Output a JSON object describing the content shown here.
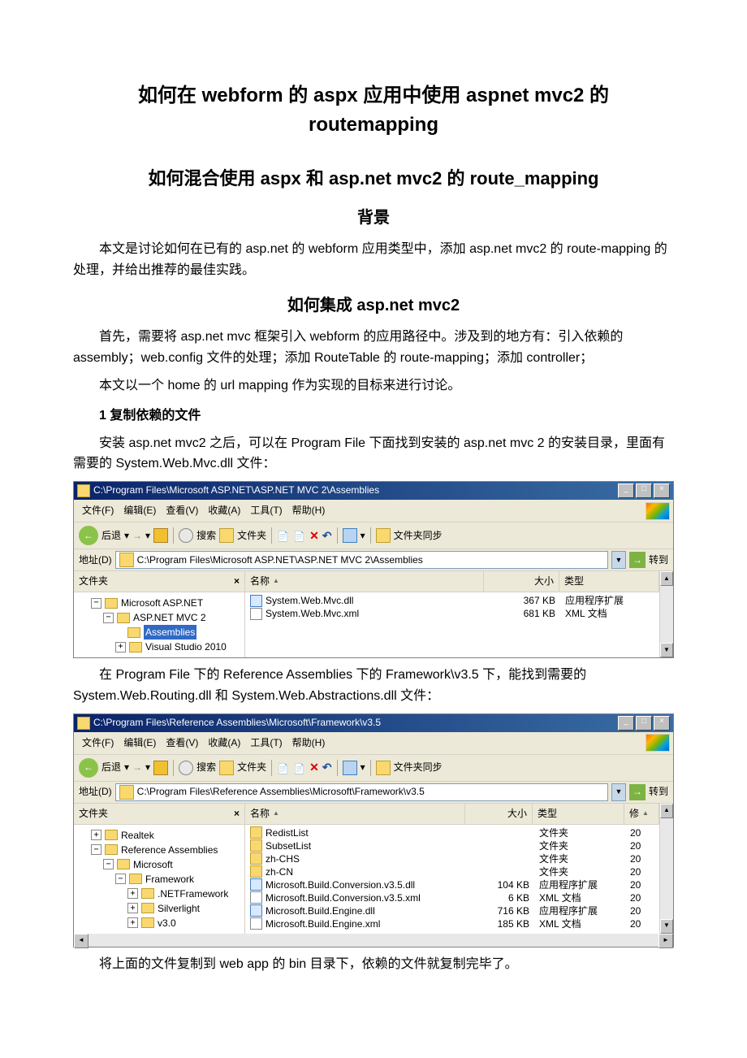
{
  "title": "如何在 webform 的 aspx 应用中使用 aspnet mvc2 的 routemapping",
  "subtitle": "如何混合使用 aspx 和 asp.net mvc2 的 route_mapping",
  "sec1": {
    "h": "背景",
    "p1": "本文是讨论如何在已有的 asp.net 的 webform 应用类型中，添加 asp.net mvc2 的 route-mapping 的处理，并给出推荐的最佳实践。"
  },
  "sec2": {
    "h": "如何集成 asp.net mvc2",
    "p1": "首先，需要将 asp.net mvc 框架引入 webform 的应用路径中。涉及到的地方有：引入依赖的 assembly；web.config 文件的处理；添加 RouteTable 的 route-mapping；添加 controller；",
    "p2": "本文以一个 home 的 url mapping 作为实现的目标来进行讨论。",
    "h2": "1 复制依赖的文件",
    "p3": "安装 asp.net mvc2 之后，可以在 Program File 下面找到安装的 asp.net mvc 2 的安装目录，里面有需要的 System.Web.Mvc.dll 文件：",
    "p4": "在 Program File 下的 Reference Assemblies 下的 Framework\\v3.5 下，能找到需要的 System.Web.Routing.dll 和 System.Web.Abstractions.dll 文件：",
    "p5": "将上面的文件复制到 web app 的 bin 目录下，依赖的文件就复制完毕了。"
  },
  "win": {
    "menu": {
      "file": "文件(F)",
      "edit": "编辑(E)",
      "view": "查看(V)",
      "fav": "收藏(A)",
      "tools": "工具(T)",
      "help": "帮助(H)"
    },
    "tb": {
      "back": "后退",
      "search": "搜索",
      "folders": "文件夹",
      "sync": "文件夹同步"
    },
    "addr": {
      "label": "地址(D)",
      "go": "转到"
    },
    "left": {
      "title": "文件夹"
    },
    "cols": {
      "name": "名称",
      "size": "大小",
      "type": "类型",
      "mod": "修"
    }
  },
  "exp1": {
    "title": "C:\\Program Files\\Microsoft ASP.NET\\ASP.NET MVC 2\\Assemblies",
    "addr": "C:\\Program Files\\Microsoft ASP.NET\\ASP.NET MVC 2\\Assemblies",
    "tree": {
      "n1": "Microsoft ASP.NET",
      "n2": "ASP.NET MVC 2",
      "n3": "Assemblies",
      "n4": "Visual Studio 2010"
    },
    "files": [
      {
        "name": "System.Web.Mvc.dll",
        "size": "367 KB",
        "type": "应用程序扩展",
        "ic": "dll"
      },
      {
        "name": "System.Web.Mvc.xml",
        "size": "681 KB",
        "type": "XML 文档",
        "ic": "xml"
      }
    ]
  },
  "exp2": {
    "title": "C:\\Program Files\\Reference Assemblies\\Microsoft\\Framework\\v3.5",
    "addr": "C:\\Program Files\\Reference Assemblies\\Microsoft\\Framework\\v3.5",
    "tree": {
      "n1": "Realtek",
      "n2": "Reference Assemblies",
      "n3": "Microsoft",
      "n4": "Framework",
      "n5": ".NETFramework",
      "n6": "Silverlight",
      "n7": "v3.0"
    },
    "files": [
      {
        "name": "RedistList",
        "size": "",
        "type": "文件夹",
        "mod": "20",
        "ic": "fold"
      },
      {
        "name": "SubsetList",
        "size": "",
        "type": "文件夹",
        "mod": "20",
        "ic": "fold"
      },
      {
        "name": "zh-CHS",
        "size": "",
        "type": "文件夹",
        "mod": "20",
        "ic": "fold"
      },
      {
        "name": "zh-CN",
        "size": "",
        "type": "文件夹",
        "mod": "20",
        "ic": "fold"
      },
      {
        "name": "Microsoft.Build.Conversion.v3.5.dll",
        "size": "104 KB",
        "type": "应用程序扩展",
        "mod": "20",
        "ic": "dll"
      },
      {
        "name": "Microsoft.Build.Conversion.v3.5.xml",
        "size": "6 KB",
        "type": "XML 文档",
        "mod": "20",
        "ic": "xml"
      },
      {
        "name": "Microsoft.Build.Engine.dll",
        "size": "716 KB",
        "type": "应用程序扩展",
        "mod": "20",
        "ic": "dll"
      },
      {
        "name": "Microsoft.Build.Engine.xml",
        "size": "185 KB",
        "type": "XML 文档",
        "mod": "20",
        "ic": "xml"
      }
    ]
  }
}
